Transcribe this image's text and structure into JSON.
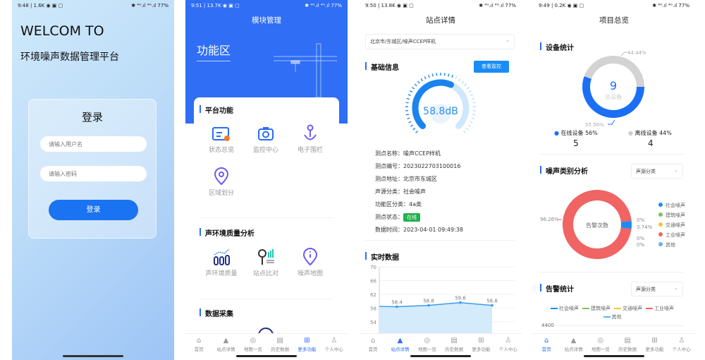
{
  "tabbar": [
    "首页",
    "站点详情",
    "地图一览",
    "历史数据",
    "更多功能",
    "个人中心"
  ],
  "status_right": "✱ ⁴ᴳ.ıl ⁴ᴳ.ıl 77%",
  "login": {
    "status_left": "9:48 | 1.6K ◉ ▣ ▢",
    "welcome": "WELCOM TO",
    "platform": "环境噪声数据管理平台",
    "card_title": "登录",
    "username_placeholder": "请输入用户名",
    "password_placeholder": "请输入密码",
    "login_button": "登录"
  },
  "modules": {
    "status_left": "9:51 | 13.7K ◉ ▣ ▢",
    "title": "模块管理",
    "banner": "功能区",
    "sections": [
      {
        "title": "平台功能",
        "items": [
          "状态总览",
          "监控中心",
          "电子围栏",
          "区域划分"
        ]
      },
      {
        "title": "声环境质量分析",
        "items": [
          "声环境质量",
          "站点比对",
          "噪声地图"
        ]
      },
      {
        "title": "数据采集",
        "items": []
      }
    ],
    "active_tab": "更多功能"
  },
  "station": {
    "status_left": "9:50 | 13.8K ◉ ▣ ▢",
    "title": "站点详情",
    "selector": "北京市/东城区/噪声CCEP样机",
    "basic_title": "基础信息",
    "monitor_button": "查看监控",
    "gauge": {
      "value": 58.8,
      "display": "58.8dB",
      "max": 100
    },
    "info": [
      {
        "label": "测点名称：",
        "value": "噪声CCEP样机"
      },
      {
        "label": "测点编号：",
        "value": "2023022703100016"
      },
      {
        "label": "测点地址：",
        "value": "北京市东城区"
      },
      {
        "label": "声源分类：",
        "value": "社会噪声"
      },
      {
        "label": "功能区分类：",
        "value": "4a类"
      },
      {
        "label": "测点状态：",
        "value": "在线"
      },
      {
        "label": "数据时间：",
        "value": "2023-04-01 09:49:38"
      }
    ],
    "status_color": "#22b14c",
    "realtime_title": "实时数据",
    "active_tab": "站点详情"
  },
  "overview": {
    "status_left": "9:49 | 0.2K ◉ ▣ ▢",
    "title": "项目总览",
    "device_title": "设备统计",
    "total": "9",
    "total_label": "总设备",
    "online": {
      "label": "在线设备 56%",
      "count": "5",
      "pct_label": "55.56%",
      "color": "#1a6ff5"
    },
    "offline": {
      "label": "离线设备 44%",
      "count": "4",
      "pct_label": "44.44%",
      "color": "#d3d3d3"
    },
    "noise_title": "噪声类别分析",
    "noise_select": "声源分类",
    "noise_center": "告警次数",
    "alarm_title": "告警统计",
    "alarm_select": "声源分类",
    "alarm_axis_top": "4400",
    "active_tab": "首页"
  },
  "chart_data": [
    {
      "type": "area",
      "ylim": [
        54,
        70
      ],
      "yticks": [
        "70",
        "66",
        "62",
        "58",
        "54"
      ],
      "values": [
        58.4,
        58.8,
        59.6,
        58.8
      ],
      "labels": [
        "58.4",
        "58.8",
        "59.6",
        "58.8"
      ],
      "color": "#3a9cf0"
    },
    {
      "type": "pie",
      "categories": [
        "在线设备",
        "离线设备"
      ],
      "values": [
        55.56,
        44.44
      ],
      "colors": [
        "#1a6ff5",
        "#d3d3d3"
      ]
    },
    {
      "type": "pie",
      "categories": [
        "社会噪声",
        "建筑噪声",
        "交通噪声",
        "工业噪声",
        "其他"
      ],
      "values": [
        3.74,
        0,
        0,
        96.26,
        0
      ],
      "labels": [
        "3.74%",
        "0%",
        "0%",
        "96.26%",
        "0%"
      ],
      "colors": [
        "#1a8cf5",
        "#7cc45a",
        "#f5c342",
        "#f06464",
        "#5bb8e8"
      ],
      "legend": "right"
    },
    {
      "type": "line",
      "legend_entries": [
        "社会噪声",
        "建筑噪声",
        "交通噪声",
        "工业噪声",
        "其他"
      ],
      "colors": [
        "#1a8cf5",
        "#7cc45a",
        "#f5c342",
        "#f06464",
        "#5bb8e8"
      ],
      "yticks": [
        "4400"
      ]
    }
  ]
}
